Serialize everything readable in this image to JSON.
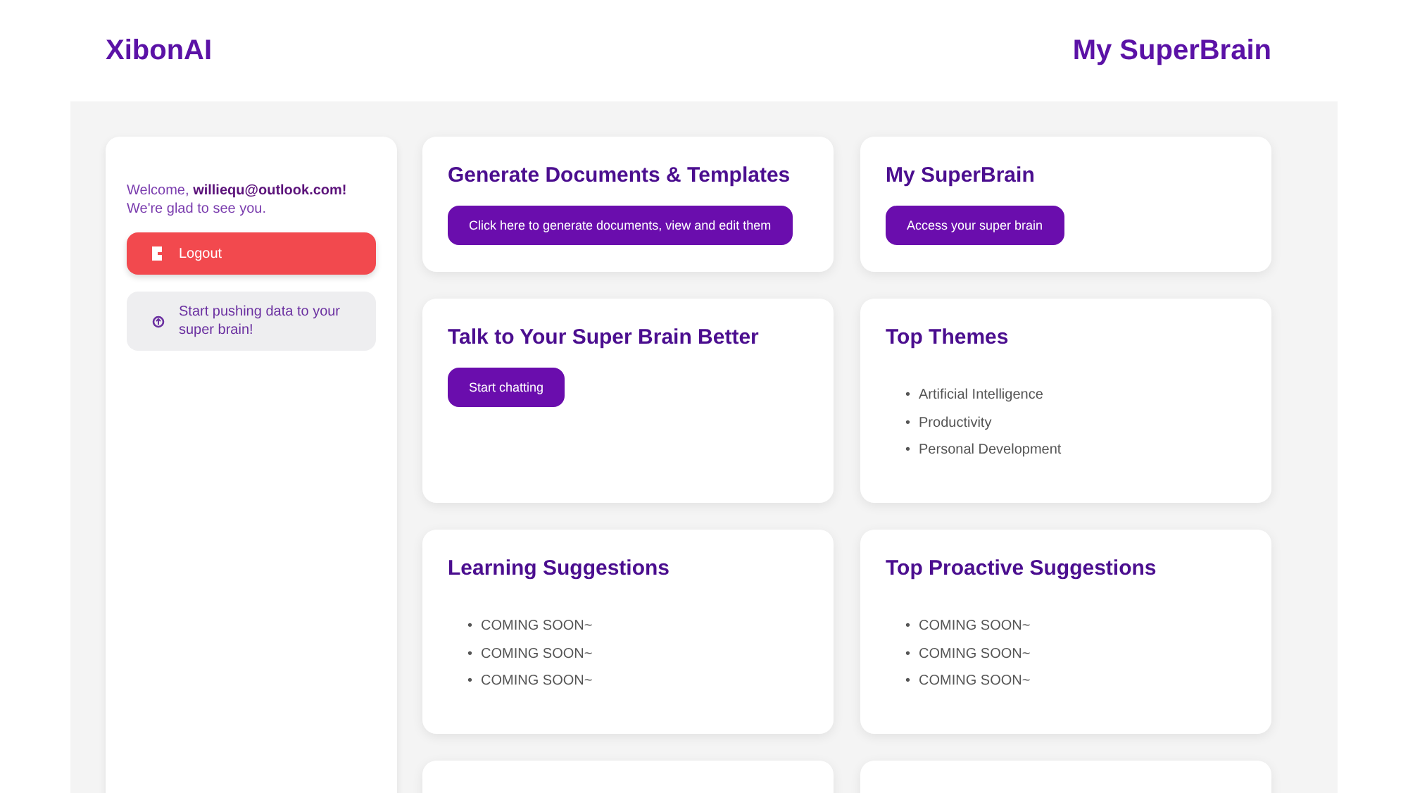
{
  "header": {
    "brand": "XibonAI",
    "title": "My SuperBrain"
  },
  "sidebar": {
    "welcome": "Welcome, **williequ@outlook.com!** We're glad to see you.",
    "logout": "Logout",
    "push": "Start pushing data to your super brain!"
  },
  "cards": [
    {
      "kind": "action",
      "title": "Generate Documents & Templates",
      "button": "Click here to generate documents, view and edit them"
    },
    {
      "kind": "action",
      "title": "My SuperBrain",
      "button": "Access your super brain"
    },
    {
      "kind": "action",
      "title": "Talk to Your Super Brain Better",
      "button": "Start chatting"
    },
    {
      "kind": "list",
      "title": "Top Themes",
      "items": [
        {
          "bullet": "•",
          "text": "Artificial Intelligence"
        },
        {
          "bullet": "•",
          "text": "Productivity"
        },
        {
          "bullet": "•",
          "text": "Personal Development"
        }
      ]
    },
    {
      "kind": "list",
      "title": "Learning Suggestions",
      "items": [
        {
          "bullet": "•",
          "text": "COMING SOON~"
        },
        {
          "bullet": "•",
          "text": "COMING SOON~"
        },
        {
          "bullet": "•",
          "text": "COMING SOON~"
        }
      ]
    },
    {
      "kind": "list",
      "title": "Top Proactive Suggestions",
      "items": [
        {
          "bullet": "•",
          "text": "COMING SOON~"
        },
        {
          "bullet": "•",
          "text": "COMING SOON~"
        },
        {
          "bullet": "•",
          "text": "COMING SOON~"
        }
      ]
    },
    {
      "kind": "cut"
    },
    {
      "kind": "cut"
    }
  ]
}
